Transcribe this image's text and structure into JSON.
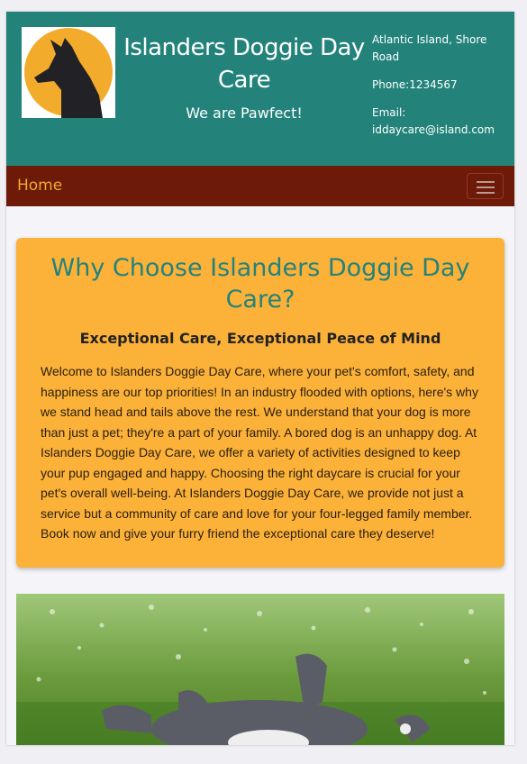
{
  "header": {
    "title": "Islanders Doggie Day Care",
    "tagline": "We are Pawfect!",
    "contact": {
      "address": "Atlantic Island, Shore Road",
      "phone": "Phone:1234567",
      "email": "Email: iddaycare@island.com"
    }
  },
  "nav": {
    "home_label": "Home",
    "menu_icon": "hamburger-icon"
  },
  "main": {
    "heading": "Why Choose Islanders Doggie Day Care?",
    "subheading": "Exceptional Care, Exceptional Peace of Mind",
    "body": "Welcome to Islanders Doggie Day Care, where your pet's comfort, safety, and happiness are our top priorities! In an industry flooded with options, here's why we stand head and tails above the rest. We understand that your dog is more than just a pet; they're a part of your family. A bored dog is an unhappy dog. At Islanders Doggie Day Care, we offer a variety of activities designed to keep your pup engaged and happy. Choosing the right daycare is crucial for your pet's overall well-being. At Islanders Doggie Day Care, we provide not just a service but a community of care and love for your four-legged family member. Book now and give your furry friend the exceptional care they deserve!"
  },
  "colors": {
    "header_bg": "#23837b",
    "nav_bg": "#6e1a08",
    "accent_orange": "#fcb139",
    "nav_link": "#f4a92e"
  }
}
